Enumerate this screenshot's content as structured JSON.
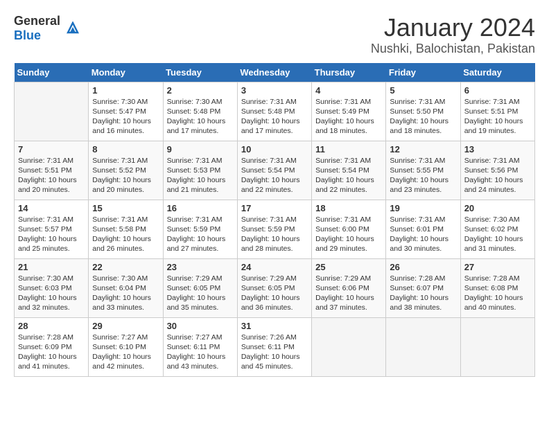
{
  "header": {
    "logo_general": "General",
    "logo_blue": "Blue",
    "month_title": "January 2024",
    "location": "Nushki, Balochistan, Pakistan"
  },
  "days_of_week": [
    "Sunday",
    "Monday",
    "Tuesday",
    "Wednesday",
    "Thursday",
    "Friday",
    "Saturday"
  ],
  "weeks": [
    [
      {
        "day": "",
        "content": ""
      },
      {
        "day": "1",
        "content": "Sunrise: 7:30 AM\nSunset: 5:47 PM\nDaylight: 10 hours\nand 16 minutes."
      },
      {
        "day": "2",
        "content": "Sunrise: 7:30 AM\nSunset: 5:48 PM\nDaylight: 10 hours\nand 17 minutes."
      },
      {
        "day": "3",
        "content": "Sunrise: 7:31 AM\nSunset: 5:48 PM\nDaylight: 10 hours\nand 17 minutes."
      },
      {
        "day": "4",
        "content": "Sunrise: 7:31 AM\nSunset: 5:49 PM\nDaylight: 10 hours\nand 18 minutes."
      },
      {
        "day": "5",
        "content": "Sunrise: 7:31 AM\nSunset: 5:50 PM\nDaylight: 10 hours\nand 18 minutes."
      },
      {
        "day": "6",
        "content": "Sunrise: 7:31 AM\nSunset: 5:51 PM\nDaylight: 10 hours\nand 19 minutes."
      }
    ],
    [
      {
        "day": "7",
        "content": "Sunrise: 7:31 AM\nSunset: 5:51 PM\nDaylight: 10 hours\nand 20 minutes."
      },
      {
        "day": "8",
        "content": "Sunrise: 7:31 AM\nSunset: 5:52 PM\nDaylight: 10 hours\nand 20 minutes."
      },
      {
        "day": "9",
        "content": "Sunrise: 7:31 AM\nSunset: 5:53 PM\nDaylight: 10 hours\nand 21 minutes."
      },
      {
        "day": "10",
        "content": "Sunrise: 7:31 AM\nSunset: 5:54 PM\nDaylight: 10 hours\nand 22 minutes."
      },
      {
        "day": "11",
        "content": "Sunrise: 7:31 AM\nSunset: 5:54 PM\nDaylight: 10 hours\nand 22 minutes."
      },
      {
        "day": "12",
        "content": "Sunrise: 7:31 AM\nSunset: 5:55 PM\nDaylight: 10 hours\nand 23 minutes."
      },
      {
        "day": "13",
        "content": "Sunrise: 7:31 AM\nSunset: 5:56 PM\nDaylight: 10 hours\nand 24 minutes."
      }
    ],
    [
      {
        "day": "14",
        "content": "Sunrise: 7:31 AM\nSunset: 5:57 PM\nDaylight: 10 hours\nand 25 minutes."
      },
      {
        "day": "15",
        "content": "Sunrise: 7:31 AM\nSunset: 5:58 PM\nDaylight: 10 hours\nand 26 minutes."
      },
      {
        "day": "16",
        "content": "Sunrise: 7:31 AM\nSunset: 5:59 PM\nDaylight: 10 hours\nand 27 minutes."
      },
      {
        "day": "17",
        "content": "Sunrise: 7:31 AM\nSunset: 5:59 PM\nDaylight: 10 hours\nand 28 minutes."
      },
      {
        "day": "18",
        "content": "Sunrise: 7:31 AM\nSunset: 6:00 PM\nDaylight: 10 hours\nand 29 minutes."
      },
      {
        "day": "19",
        "content": "Sunrise: 7:31 AM\nSunset: 6:01 PM\nDaylight: 10 hours\nand 30 minutes."
      },
      {
        "day": "20",
        "content": "Sunrise: 7:30 AM\nSunset: 6:02 PM\nDaylight: 10 hours\nand 31 minutes."
      }
    ],
    [
      {
        "day": "21",
        "content": "Sunrise: 7:30 AM\nSunset: 6:03 PM\nDaylight: 10 hours\nand 32 minutes."
      },
      {
        "day": "22",
        "content": "Sunrise: 7:30 AM\nSunset: 6:04 PM\nDaylight: 10 hours\nand 33 minutes."
      },
      {
        "day": "23",
        "content": "Sunrise: 7:29 AM\nSunset: 6:05 PM\nDaylight: 10 hours\nand 35 minutes."
      },
      {
        "day": "24",
        "content": "Sunrise: 7:29 AM\nSunset: 6:05 PM\nDaylight: 10 hours\nand 36 minutes."
      },
      {
        "day": "25",
        "content": "Sunrise: 7:29 AM\nSunset: 6:06 PM\nDaylight: 10 hours\nand 37 minutes."
      },
      {
        "day": "26",
        "content": "Sunrise: 7:28 AM\nSunset: 6:07 PM\nDaylight: 10 hours\nand 38 minutes."
      },
      {
        "day": "27",
        "content": "Sunrise: 7:28 AM\nSunset: 6:08 PM\nDaylight: 10 hours\nand 40 minutes."
      }
    ],
    [
      {
        "day": "28",
        "content": "Sunrise: 7:28 AM\nSunset: 6:09 PM\nDaylight: 10 hours\nand 41 minutes."
      },
      {
        "day": "29",
        "content": "Sunrise: 7:27 AM\nSunset: 6:10 PM\nDaylight: 10 hours\nand 42 minutes."
      },
      {
        "day": "30",
        "content": "Sunrise: 7:27 AM\nSunset: 6:11 PM\nDaylight: 10 hours\nand 43 minutes."
      },
      {
        "day": "31",
        "content": "Sunrise: 7:26 AM\nSunset: 6:11 PM\nDaylight: 10 hours\nand 45 minutes."
      },
      {
        "day": "",
        "content": ""
      },
      {
        "day": "",
        "content": ""
      },
      {
        "day": "",
        "content": ""
      }
    ]
  ]
}
